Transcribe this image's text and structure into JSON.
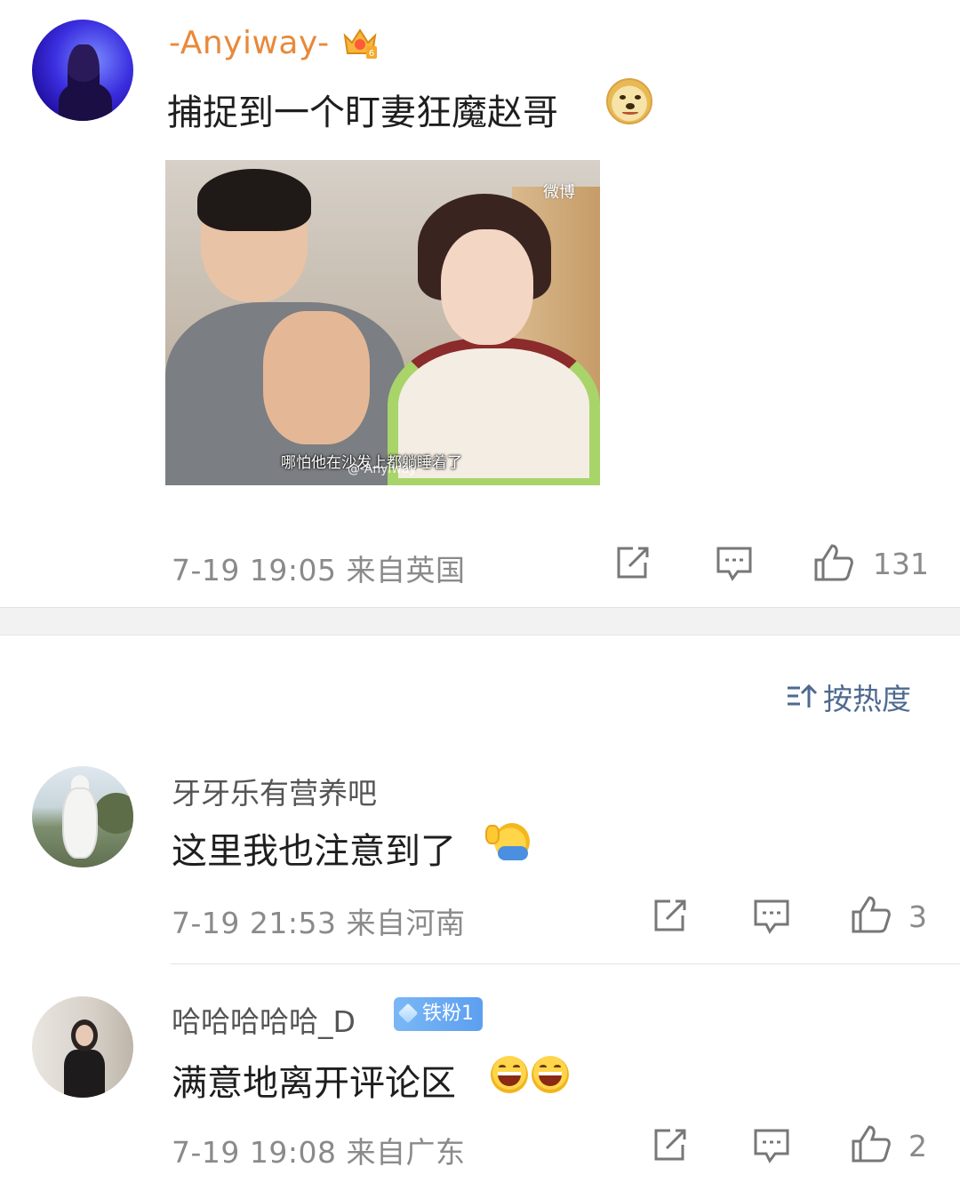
{
  "main_post": {
    "username": "-Anyiway-",
    "text": "捕捉到一个盯妻狂魔赵哥",
    "image": {
      "caption": "哪怕他在沙发上都躺睡着了",
      "watermark_top": "微博",
      "watermark_bottom": "@-Anyiway-"
    },
    "time": "7-19 19:05",
    "location": "来自英国",
    "like_count": "131"
  },
  "sort": {
    "label": "按热度"
  },
  "comments": [
    {
      "username": "牙牙乐有营养吧",
      "text": "这里我也注意到了",
      "time": "7-19 21:53",
      "location": "来自河南",
      "like_count": "3"
    },
    {
      "username": "哈哈哈哈哈_D",
      "badge": "铁粉1",
      "text": "满意地离开评论区",
      "time": "7-19 19:08",
      "location": "来自广东",
      "like_count": "2"
    }
  ],
  "colors": {
    "username_vip": "#e8893a",
    "sort_link": "#4e6a8f",
    "meta_gray": "#8a8a8a",
    "badge_blue": "#5d9ff0"
  },
  "icons": [
    "crown-icon",
    "doge-emoji",
    "share-icon",
    "comment-icon",
    "like-icon",
    "sort-icon",
    "wave-emoji",
    "laugh-emoji",
    "diamond-icon"
  ]
}
